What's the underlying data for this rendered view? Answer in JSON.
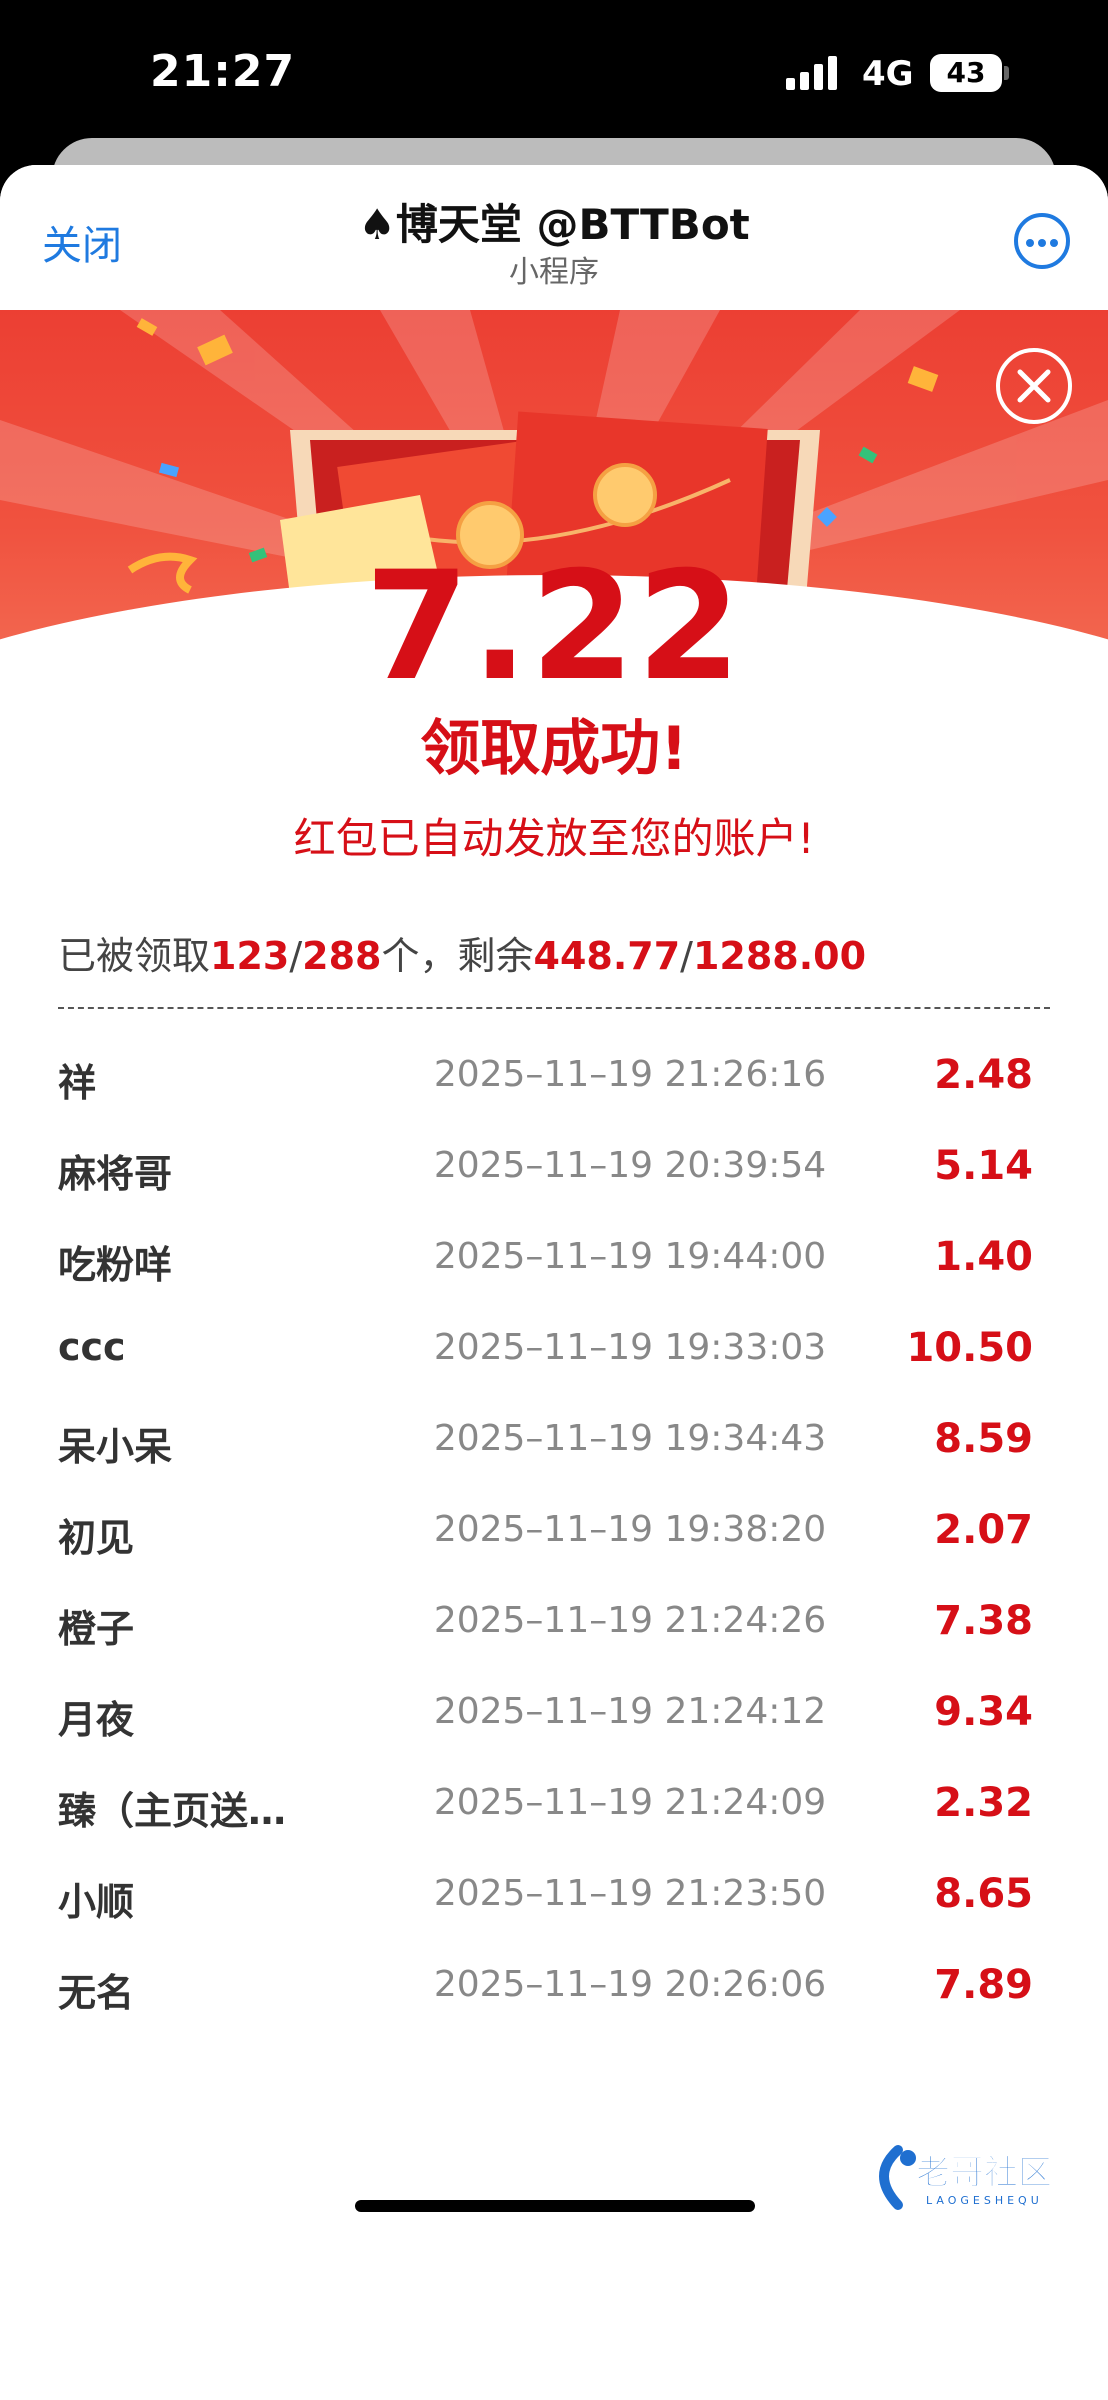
{
  "status": {
    "time": "21:27",
    "network": "4G",
    "battery": "43"
  },
  "nav": {
    "close_label": "关闭",
    "title": "♠博天堂 @BTTBot",
    "subtitle": "小程序"
  },
  "result": {
    "amount": "7.22",
    "success_text": "领取成功!",
    "notice": "红包已自动发放至您的账户!"
  },
  "summary": {
    "prefix": "已被领取",
    "claimed": "123",
    "slash1": "/",
    "total": "288",
    "mid": "个，剩余",
    "remaining": "448.77",
    "slash2": "/",
    "total_amount": "1288.00"
  },
  "records": [
    {
      "name": "祥",
      "time": "2025–11–19 21:26:16",
      "amount": "2.48"
    },
    {
      "name": "麻将哥",
      "time": "2025–11–19 20:39:54",
      "amount": "5.14"
    },
    {
      "name": "吃粉咩",
      "time": "2025–11–19 19:44:00",
      "amount": "1.40"
    },
    {
      "name": "ccc",
      "time": "2025–11–19 19:33:03",
      "amount": "10.50"
    },
    {
      "name": "呆小呆",
      "time": "2025–11–19 19:34:43",
      "amount": "8.59"
    },
    {
      "name": "初见",
      "time": "2025–11–19 19:38:20",
      "amount": "2.07"
    },
    {
      "name": "橙子",
      "time": "2025–11–19 21:24:26",
      "amount": "7.38"
    },
    {
      "name": "月夜",
      "time": "2025–11–19 21:24:12",
      "amount": "9.34"
    },
    {
      "name": "臻（主页送…",
      "time": "2025–11–19 21:24:09",
      "amount": "2.32"
    },
    {
      "name": "小顺",
      "time": "2025–11–19 21:23:50",
      "amount": "8.65"
    },
    {
      "name": "无名",
      "time": "2025–11–19 20:26:06",
      "amount": "7.89"
    }
  ],
  "watermark": {
    "text": "老哥社区",
    "subtext": "LAOGESHEQU"
  },
  "colors": {
    "accent_red": "#d60f17",
    "link_blue": "#1f7ae0",
    "banner_red": "#ec3f33"
  }
}
